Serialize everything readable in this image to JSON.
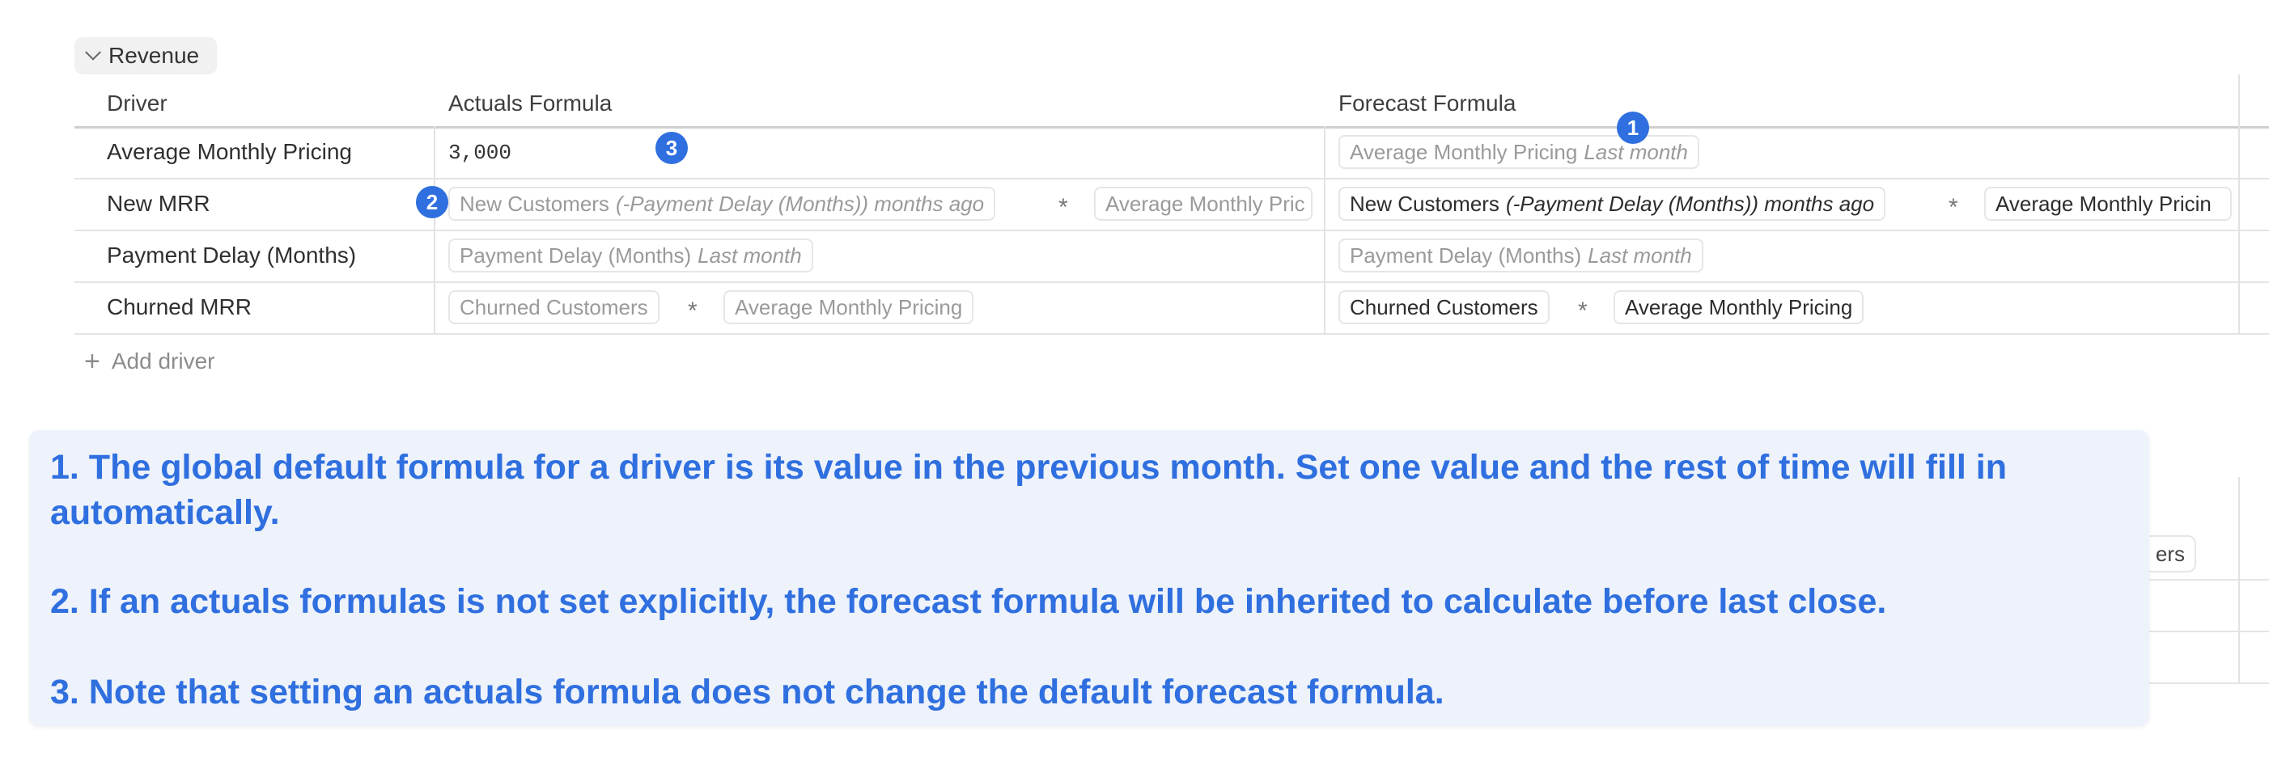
{
  "section": {
    "label": "Revenue"
  },
  "table": {
    "headers": {
      "driver": "Driver",
      "actuals": "Actuals Formula",
      "forecast": "Forecast Formula"
    },
    "rows": [
      {
        "driver": "Average Monthly Pricing",
        "actuals_value": "3,000",
        "forecast_chip": {
          "text": "Average Monthly Pricing",
          "modifier": "Last month"
        }
      },
      {
        "driver": "New MRR",
        "actuals_chips": [
          {
            "text": "New Customers",
            "modifier": "(-Payment Delay (Months)) months ago"
          },
          {
            "text": "Average Monthly Pric"
          }
        ],
        "forecast_chips": [
          {
            "text": "New Customers",
            "modifier": "(-Payment Delay (Months)) months ago"
          },
          {
            "text": "Average Monthly Pricin"
          }
        ],
        "operator": "*"
      },
      {
        "driver": "Payment Delay (Months)",
        "actuals_chip": {
          "text": "Payment Delay (Months)",
          "modifier": "Last month"
        },
        "forecast_chip": {
          "text": "Payment Delay (Months)",
          "modifier": "Last month"
        }
      },
      {
        "driver": "Churned MRR",
        "actuals_chips": [
          {
            "text": "Churned Customers"
          },
          {
            "text": "Average Monthly Pricing"
          }
        ],
        "forecast_chips": [
          {
            "text": "Churned Customers"
          },
          {
            "text": "Average Monthly Pricing"
          }
        ],
        "operator": "*"
      }
    ]
  },
  "add_driver": {
    "label": "Add driver"
  },
  "badges": [
    "1",
    "2",
    "3"
  ],
  "callout": {
    "line1": "1. The global default formula for a driver is its value in the previous month. Set one value and the rest of time will fill in automatically.",
    "line2": "2. If an actuals formulas is not set explicitly, the forecast formula will be inherited to calculate before last close.",
    "line3": "3. Note that setting an actuals formula does not change the default forecast formula."
  },
  "background_partial_chip": "ers",
  "colors": {
    "accent": "#2f6fdf",
    "callout_bg": "#edf2fb"
  }
}
